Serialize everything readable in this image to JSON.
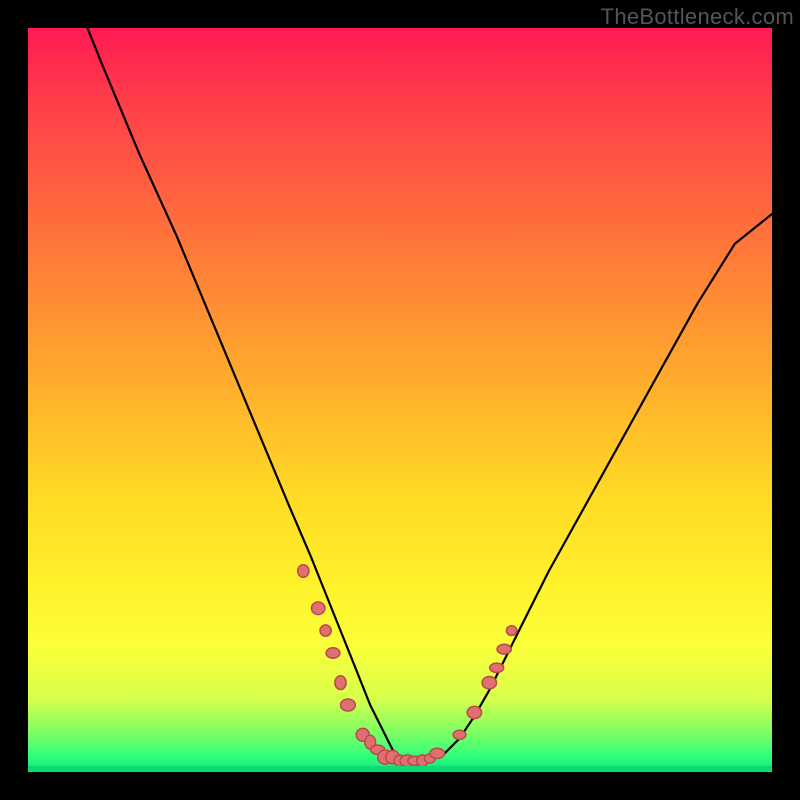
{
  "watermark": "TheBottleneck.com",
  "colors": {
    "frame": "#000000",
    "gradient_top": "#ff1a52",
    "gradient_mid": "#ffd825",
    "gradient_bottom": "#11e47a",
    "curve": "#000000",
    "scatter_fill": "#e07070",
    "scatter_stroke": "#b84a4a"
  },
  "chart_data": {
    "type": "line",
    "title": "",
    "xlabel": "",
    "ylabel": "",
    "xlim": [
      0,
      100
    ],
    "ylim": [
      0,
      100
    ],
    "grid": false,
    "series": [
      {
        "name": "curve",
        "x": [
          8,
          10,
          15,
          20,
          25,
          30,
          35,
          38,
          40,
          42,
          44,
          46,
          48,
          49,
          50,
          51,
          52,
          53,
          54,
          56,
          58,
          60,
          62,
          64,
          66,
          70,
          75,
          80,
          85,
          90,
          95,
          100
        ],
        "y": [
          100,
          95,
          83,
          72,
          60,
          48,
          36,
          29,
          24,
          19,
          14,
          9,
          5,
          3,
          2,
          1.5,
          1.2,
          1.2,
          1.5,
          2.5,
          4.5,
          7.5,
          11,
          15,
          19,
          27,
          36,
          45,
          54,
          63,
          71,
          75
        ]
      }
    ],
    "scatter": {
      "name": "scatter-points",
      "x": [
        37,
        39,
        40,
        41,
        42,
        43,
        45,
        46,
        47,
        48,
        49,
        50,
        51,
        52,
        53,
        54,
        55,
        58,
        60,
        62,
        63,
        64,
        65
      ],
      "y": [
        27,
        22,
        19,
        16,
        12,
        9,
        5,
        4,
        3,
        2,
        2,
        1.5,
        1.5,
        1.5,
        1.5,
        1.8,
        2.5,
        5,
        8,
        12,
        14,
        16.5,
        19
      ],
      "marker_radius": 6
    }
  }
}
